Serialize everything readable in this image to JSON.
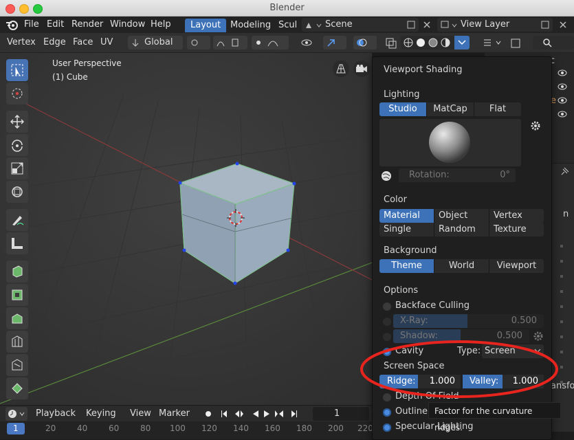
{
  "window": {
    "title": "Blender"
  },
  "menubar": {
    "items": [
      "File",
      "Edit",
      "Render",
      "Window",
      "Help"
    ],
    "workspace_tabs": [
      "Layout",
      "Modeling",
      "Scul"
    ],
    "scene": "Scene",
    "view_layer": "View Layer"
  },
  "header": {
    "modes": [
      "Vertex",
      "Edge",
      "Face",
      "UV"
    ],
    "orientation": "Global"
  },
  "viewport": {
    "view_name": "User Perspective",
    "object_name": "(1) Cube"
  },
  "outliner": {
    "partial_texts": [
      "c",
      "e"
    ]
  },
  "properties": {
    "partial_texts": [
      "n",
      "ansfor"
    ]
  },
  "shading_popover": {
    "title": "Viewport Shading",
    "lighting": {
      "label": "Lighting",
      "options": [
        "Studio",
        "MatCap",
        "Flat"
      ],
      "selected": "Studio",
      "rotation_label": "Rotation:",
      "rotation_value": "0°"
    },
    "color": {
      "label": "Color",
      "options": [
        "Material",
        "Object",
        "Vertex",
        "Single",
        "Random",
        "Texture"
      ],
      "selected": "Material"
    },
    "background": {
      "label": "Background",
      "options": [
        "Theme",
        "World",
        "Viewport"
      ],
      "selected": "Theme"
    },
    "options": {
      "label": "Options",
      "backface_culling": "Backface Culling",
      "xray_label": "X-Ray:",
      "xray_value": "0.500",
      "shadow_label": "Shadow:",
      "shadow_value": "0.500",
      "cavity_label": "Cavity",
      "type_label": "Type:",
      "type_value": "Screen",
      "screen_space_label": "Screen Space",
      "ridge_label": "Ridge:",
      "ridge_value": "1.000",
      "valley_label": "Valley:",
      "valley_value": "1.000",
      "depth_of_field": "Depth Of Field",
      "outline": "Outline",
      "specular_lighting": "Specular Lighting"
    }
  },
  "tooltip": {
    "text": "Factor for the curvature ridges."
  },
  "timeline": {
    "items": [
      "Playback",
      "Keying",
      "View",
      "Marker"
    ],
    "current_frame": "1",
    "ruler_ticks": [
      "1",
      "20",
      "40",
      "60",
      "80",
      "100",
      "120",
      "140",
      "160",
      "180",
      "200",
      "220"
    ]
  },
  "colors": {
    "accent": "#3d72b8",
    "annotation": "#e8241e",
    "viewport_bg": "#3a3a3a"
  }
}
